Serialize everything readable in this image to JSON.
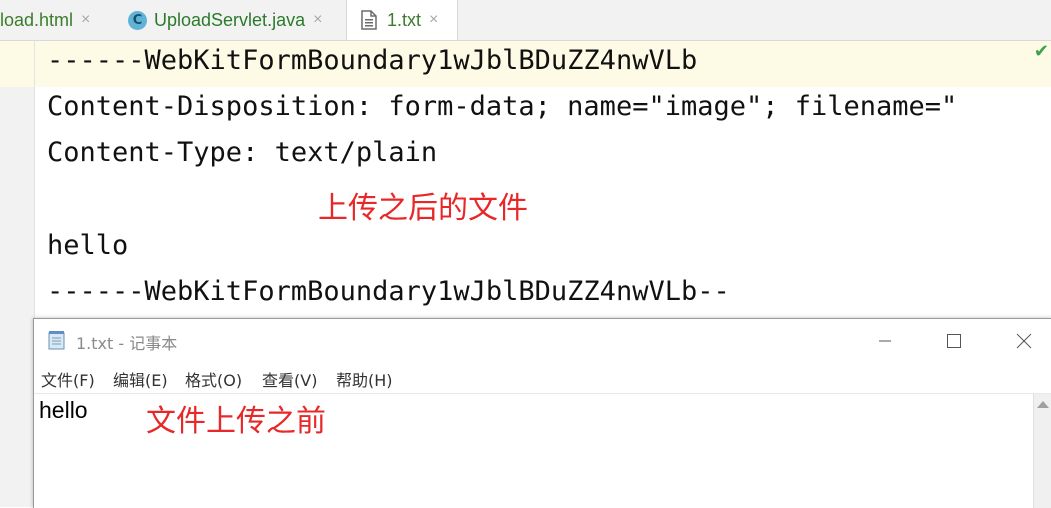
{
  "ide": {
    "tabs": [
      {
        "label": "load.html",
        "close": "×"
      },
      {
        "label": "UploadServlet.java",
        "icon_letter": "C",
        "close": "×"
      },
      {
        "label": "1.txt",
        "close": "×"
      }
    ],
    "lines": [
      "------WebKitFormBoundary1wJblBDuZZ4nwVLb",
      "Content-Disposition: form-data; name=\"image\"; filename=\"",
      "Content-Type: text/plain",
      "",
      "hello",
      "------WebKitFormBoundary1wJblBDuZZ4nwVLb--"
    ],
    "annotation": "上传之后的文件",
    "status_icon": "check-icon"
  },
  "notepad": {
    "title": "1.txt - 记事本",
    "menu": [
      "文件(F)",
      "编辑(E)",
      "格式(O)",
      "查看(V)",
      "帮助(H)"
    ],
    "content": "hello",
    "annotation": "文件上传之前"
  },
  "colors": {
    "annotation": "#e82828",
    "tab_text": "#3b7d2a",
    "line_highlight": "#fdfbe6"
  }
}
